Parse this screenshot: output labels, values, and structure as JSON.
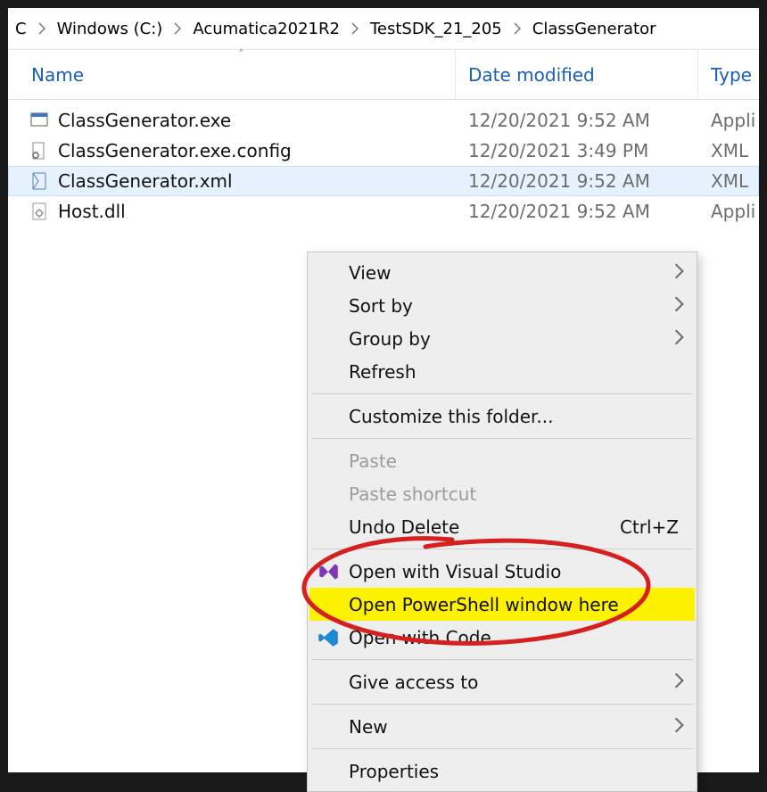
{
  "breadcrumbs": {
    "items": [
      {
        "label": "C"
      },
      {
        "label": "Windows (C:)"
      },
      {
        "label": "Acumatica2021R2"
      },
      {
        "label": "TestSDK_21_205"
      },
      {
        "label": "ClassGenerator"
      }
    ]
  },
  "columns": {
    "name": "Name",
    "date": "Date modified",
    "type": "Type"
  },
  "files": [
    {
      "name": "ClassGenerator.exe",
      "date": "12/20/2021 9:52 AM",
      "type": "Appli",
      "icon": "exe",
      "selected": false
    },
    {
      "name": "ClassGenerator.exe.config",
      "date": "12/20/2021 3:49 PM",
      "type": "XML",
      "icon": "config",
      "selected": false
    },
    {
      "name": "ClassGenerator.xml",
      "date": "12/20/2021 9:52 AM",
      "type": "XML",
      "icon": "xml",
      "selected": true
    },
    {
      "name": "Host.dll",
      "date": "12/20/2021 9:52 AM",
      "type": "Appli",
      "icon": "dll",
      "selected": false
    }
  ],
  "context_menu": {
    "view": "View",
    "sort_by": "Sort by",
    "group_by": "Group by",
    "refresh": "Refresh",
    "customize": "Customize this folder...",
    "paste": "Paste",
    "paste_shortcut": "Paste shortcut",
    "undo_delete": "Undo Delete",
    "undo_delete_shortcut": "Ctrl+Z",
    "open_vs": "Open with Visual Studio",
    "open_ps": "Open PowerShell window here",
    "open_code": "Open with Code",
    "give_access": "Give access to",
    "new": "New",
    "properties": "Properties"
  }
}
